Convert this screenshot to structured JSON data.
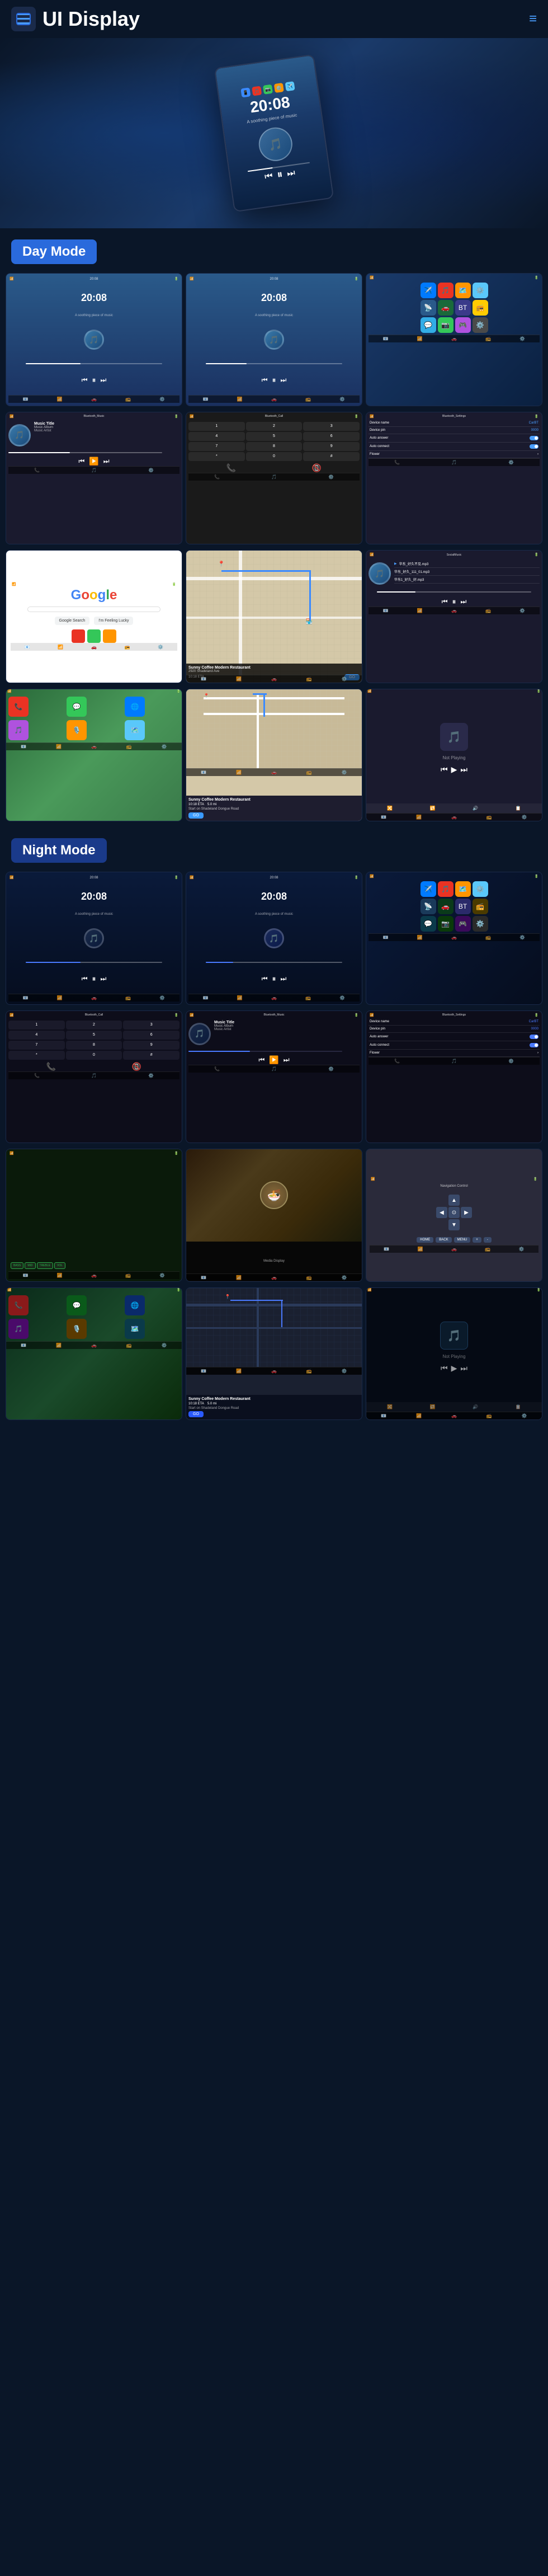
{
  "header": {
    "title": "UI Display",
    "logo_icon": "☰",
    "menu_icon": "≡"
  },
  "hero": {
    "time": "20:08",
    "subtitle": "A soothing piece of music"
  },
  "day_mode": {
    "label": "Day Mode"
  },
  "night_mode": {
    "label": "Night Mode"
  },
  "music": {
    "title": "Music Title",
    "album": "Music Album",
    "artist": "Music Artist",
    "time_display": "20:08",
    "sub": "A soothing piece of music"
  },
  "bluetooth": {
    "music_label": "Bluetooth_Music",
    "call_label": "Bluetooth_Call",
    "settings_label": "Bluetooth_Settings"
  },
  "bt_settings": {
    "device_name_label": "Device name",
    "device_name_val": "CarBT",
    "device_pin_label": "Device pin",
    "device_pin_val": "0000",
    "auto_answer_label": "Auto answer",
    "auto_connect_label": "Auto connect",
    "flower_label": "Flower"
  },
  "navigation": {
    "destination": "Sunny Coffee Modern Restaurant",
    "address": "2920 Shadeland Ave",
    "eta_label": "10:18 ETA",
    "distance": "5.0 mi",
    "start_label": "Start on Shadeland Dongue Road",
    "go_label": "GO",
    "not_playing": "Not Playing"
  },
  "social_music": {
    "label": "SocialMusic",
    "items": [
      "华东_好久不见.mp3",
      "华东_好久_111_01.mp3",
      "华东1_好久_好.mp3"
    ]
  },
  "dial_buttons": [
    "1",
    "2",
    "3",
    "4",
    "5",
    "6",
    "7",
    "8",
    "9",
    "*",
    "0",
    "#"
  ],
  "app_icons_day": [
    "📱",
    "🎵",
    "📷",
    "⚙️",
    "✈️",
    "🗺️",
    "📻",
    "🎮",
    "💬",
    "📧",
    "🔊",
    "📡"
  ],
  "app_icons_night": [
    "📱",
    "🎵",
    "📷",
    "⚙️",
    "✈️",
    "🗺️",
    "📻",
    "🎮",
    "💬",
    "📧",
    "🔊",
    "📡"
  ]
}
